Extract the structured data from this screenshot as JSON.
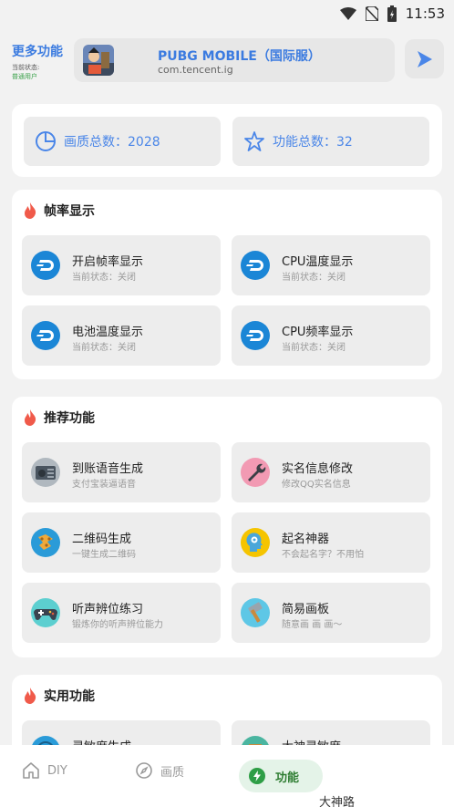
{
  "status_bar": {
    "time": "11:53",
    "icons": [
      "wifi-icon",
      "no-sim-icon",
      "battery-icon"
    ]
  },
  "header": {
    "more_title": "更多功能",
    "status_label": "当前状态:",
    "status_value": "普通用户",
    "game_name": "PUBG MOBILE（国际服）",
    "game_package": "com.tencent.ig"
  },
  "stats": {
    "quality_count": "画质总数：2028",
    "feature_count": "功能总数：32"
  },
  "sections": {
    "fps": {
      "title": "帧率显示",
      "items": [
        {
          "title": "开启帧率显示",
          "subtitle": "当前状态：关闭",
          "icon": "dash-icon"
        },
        {
          "title": "CPU温度显示",
          "subtitle": "当前状态：关闭",
          "icon": "dash-icon"
        },
        {
          "title": "电池温度显示",
          "subtitle": "当前状态：关闭",
          "icon": "dash-icon"
        },
        {
          "title": "CPU频率显示",
          "subtitle": "当前状态：关闭",
          "icon": "dash-icon"
        }
      ]
    },
    "recommend": {
      "title": "推荐功能",
      "items": [
        {
          "title": "到账语音生成",
          "subtitle": "支付宝装逼语音",
          "icon": "radio-icon"
        },
        {
          "title": "实名信息修改",
          "subtitle": "修改QQ实名信息",
          "icon": "wrench-icon"
        },
        {
          "title": "二维码生成",
          "subtitle": "一键生成二维码",
          "icon": "qrcode-icon"
        },
        {
          "title": "起名神器",
          "subtitle": "不会起名字？不用怕",
          "icon": "brain-icon"
        },
        {
          "title": "听声辨位练习",
          "subtitle": "锻炼你的听声辨位能力",
          "icon": "gamepad-icon"
        },
        {
          "title": "简易画板",
          "subtitle": "随意画 画 画～",
          "icon": "hammer-icon"
        }
      ]
    },
    "utility": {
      "title": "实用功能",
      "items": [
        {
          "title": "灵敏度生成",
          "icon": "globe-icon"
        },
        {
          "title": "大神灵敏度",
          "icon": "box-icon"
        }
      ],
      "peek_text": "大神路"
    }
  },
  "bottom_nav": {
    "items": [
      {
        "label": "DIY",
        "icon": "home-icon"
      },
      {
        "label": "画质",
        "icon": "compass-icon"
      },
      {
        "label": "功能",
        "icon": "bolt-icon"
      }
    ]
  },
  "colors": {
    "accent": "#4a86e8",
    "active_green": "#2e7d32",
    "flame": "#f05a4a",
    "dash_blue": "#1b86d6"
  }
}
